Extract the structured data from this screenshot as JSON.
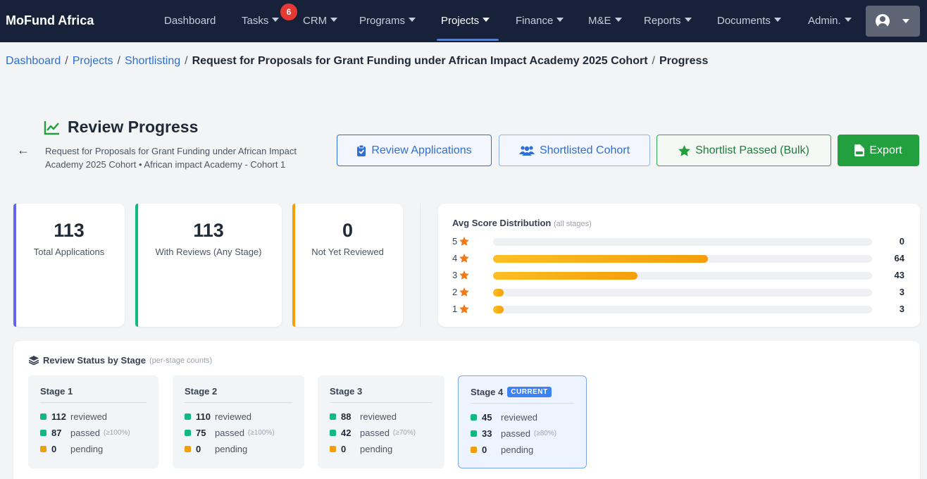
{
  "nav": {
    "brand": "MoFund Africa",
    "items": [
      {
        "label": "Dashboard",
        "caret": false
      },
      {
        "label": "Tasks",
        "caret": true
      },
      {
        "label": "CRM",
        "caret": true
      },
      {
        "label": "Programs",
        "caret": true
      },
      {
        "label": "Projects",
        "caret": true
      },
      {
        "label": "Finance",
        "caret": true
      },
      {
        "label": "M&E",
        "caret": true
      },
      {
        "label": "Reports",
        "caret": true
      },
      {
        "label": "Documents",
        "caret": true
      },
      {
        "label": "Admin.",
        "caret": true
      }
    ],
    "active": "Projects",
    "tasks_badge": "6"
  },
  "breadcrumb": {
    "dashboard": "Dashboard",
    "projects": "Projects",
    "shortlisting": "Shortlisting",
    "rfp": "Request for Proposals for Grant Funding under African Impact Academy 2025 Cohort",
    "progress": "Progress",
    "separator": "/"
  },
  "header": {
    "title": "Review Progress",
    "subtitle": "Request for Proposals for Grant Funding under African Impact Academy 2025 Cohort • African impact Academy - Cohort 1",
    "back": "←"
  },
  "actions": {
    "review": "Review Applications",
    "cohort": "Shortlisted Cohort",
    "shortlist": "Shortlist Passed (Bulk)",
    "export": "Export"
  },
  "stats": {
    "total": {
      "value": "113",
      "label": "Total Applications",
      "color": "#6366f1"
    },
    "reviewed": {
      "value": "113",
      "label": "With Reviews (Any Stage)",
      "color": "#10b981"
    },
    "not_reviewed": {
      "value": "0",
      "label": "Not Yet Reviewed",
      "color": "#f59e0b"
    }
  },
  "distribution": {
    "title": "Avg Score Distribution",
    "note": "(all stages)",
    "max": 113,
    "rows": [
      {
        "stars": "5",
        "count": 0
      },
      {
        "stars": "4",
        "count": 64
      },
      {
        "stars": "3",
        "count": 43
      },
      {
        "stars": "2",
        "count": 3
      },
      {
        "stars": "1",
        "count": 3
      }
    ]
  },
  "stages": {
    "title": "Review Status by Stage",
    "note": "(per-stage counts)",
    "reviewed_label": "reviewed",
    "passed_label": "passed",
    "pending_label": "pending",
    "current_label": "CURRENT",
    "colors": {
      "reviewed": "#10b981",
      "passed": "#10b981",
      "pending": "#f59e0b"
    },
    "items": [
      {
        "name": "Stage 1",
        "reviewed": "112",
        "passed": "87",
        "threshold": "(≥100%)",
        "pending": "0",
        "current": false
      },
      {
        "name": "Stage 2",
        "reviewed": "110",
        "passed": "75",
        "threshold": "(≥100%)",
        "pending": "0",
        "current": false
      },
      {
        "name": "Stage 3",
        "reviewed": "88",
        "passed": "42",
        "threshold": "(≥70%)",
        "pending": "0",
        "current": false
      },
      {
        "name": "Stage 4",
        "reviewed": "45",
        "passed": "33",
        "threshold": "(≥80%)",
        "pending": "0",
        "current": true
      }
    ]
  }
}
